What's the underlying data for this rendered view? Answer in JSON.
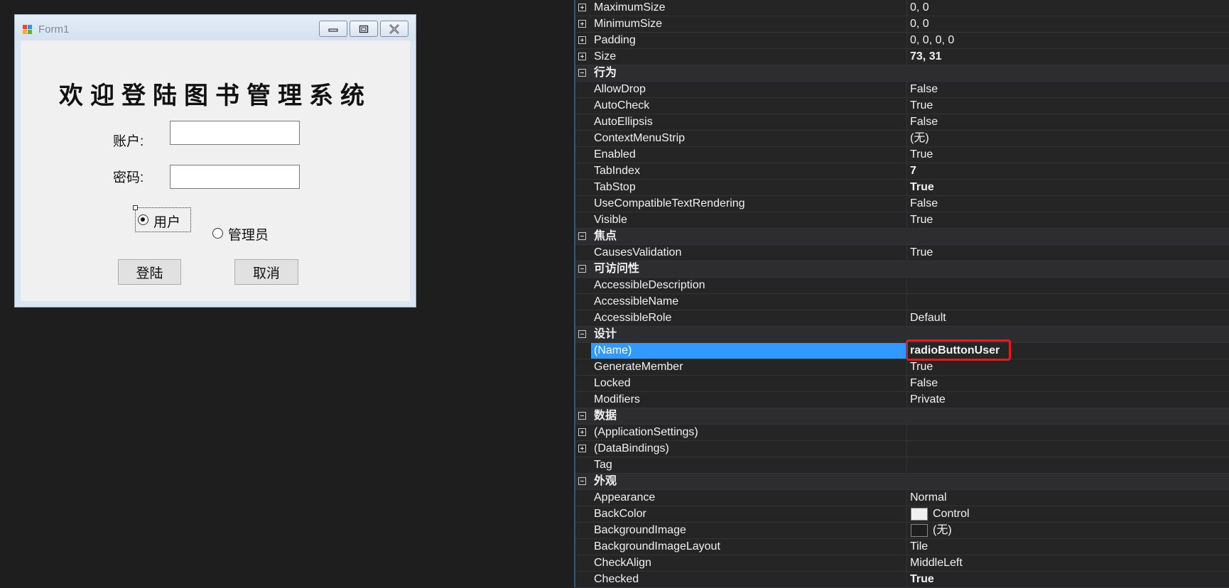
{
  "form": {
    "title": "Form1",
    "heading": "欢迎登陆图书管理系统",
    "account_label": "账户:",
    "password_label": "密码:",
    "account_value": "",
    "password_value": "",
    "radio_user_label": "用户",
    "radio_admin_label": "管理员",
    "radio_user_checked": true,
    "radio_admin_checked": false,
    "login_button": "登陆",
    "cancel_button": "取消"
  },
  "property_grid": {
    "rows": [
      {
        "type": "prop",
        "expandable": true,
        "name": "MaximumSize",
        "value": "0, 0"
      },
      {
        "type": "prop",
        "expandable": true,
        "name": "MinimumSize",
        "value": "0, 0"
      },
      {
        "type": "prop",
        "expandable": true,
        "name": "Padding",
        "value": "0, 0, 0, 0"
      },
      {
        "type": "prop",
        "expandable": true,
        "name": "Size",
        "value": "73, 31",
        "bold": true
      },
      {
        "type": "category",
        "name": "行为"
      },
      {
        "type": "prop",
        "name": "AllowDrop",
        "value": "False"
      },
      {
        "type": "prop",
        "name": "AutoCheck",
        "value": "True"
      },
      {
        "type": "prop",
        "name": "AutoEllipsis",
        "value": "False"
      },
      {
        "type": "prop",
        "name": "ContextMenuStrip",
        "value": "(无)"
      },
      {
        "type": "prop",
        "name": "Enabled",
        "value": "True"
      },
      {
        "type": "prop",
        "name": "TabIndex",
        "value": "7",
        "bold": true
      },
      {
        "type": "prop",
        "name": "TabStop",
        "value": "True",
        "bold": true
      },
      {
        "type": "prop",
        "name": "UseCompatibleTextRendering",
        "value": "False"
      },
      {
        "type": "prop",
        "name": "Visible",
        "value": "True"
      },
      {
        "type": "category",
        "name": "焦点"
      },
      {
        "type": "prop",
        "name": "CausesValidation",
        "value": "True"
      },
      {
        "type": "category",
        "name": "可访问性"
      },
      {
        "type": "prop",
        "name": "AccessibleDescription",
        "value": ""
      },
      {
        "type": "prop",
        "name": "AccessibleName",
        "value": ""
      },
      {
        "type": "prop",
        "name": "AccessibleRole",
        "value": "Default"
      },
      {
        "type": "category",
        "name": "设计"
      },
      {
        "type": "prop",
        "name": "(Name)",
        "value": "radioButtonUser",
        "selected": true
      },
      {
        "type": "prop",
        "name": "GenerateMember",
        "value": "True"
      },
      {
        "type": "prop",
        "name": "Locked",
        "value": "False"
      },
      {
        "type": "prop",
        "name": "Modifiers",
        "value": "Private"
      },
      {
        "type": "category",
        "name": "数据"
      },
      {
        "type": "prop",
        "expandable": true,
        "name": "(ApplicationSettings)",
        "value": ""
      },
      {
        "type": "prop",
        "expandable": true,
        "name": "(DataBindings)",
        "value": ""
      },
      {
        "type": "prop",
        "name": "Tag",
        "value": ""
      },
      {
        "type": "category",
        "name": "外观"
      },
      {
        "type": "prop",
        "name": "Appearance",
        "value": "Normal"
      },
      {
        "type": "prop",
        "name": "BackColor",
        "value": "Control",
        "swatch": "#f0f0f0"
      },
      {
        "type": "prop",
        "name": "BackgroundImage",
        "value": "(无)",
        "swatch": "#1e1e1e"
      },
      {
        "type": "prop",
        "name": "BackgroundImageLayout",
        "value": "Tile"
      },
      {
        "type": "prop",
        "name": "CheckAlign",
        "value": "MiddleLeft"
      },
      {
        "type": "prop",
        "name": "Checked",
        "value": "True",
        "bold": true
      }
    ]
  }
}
